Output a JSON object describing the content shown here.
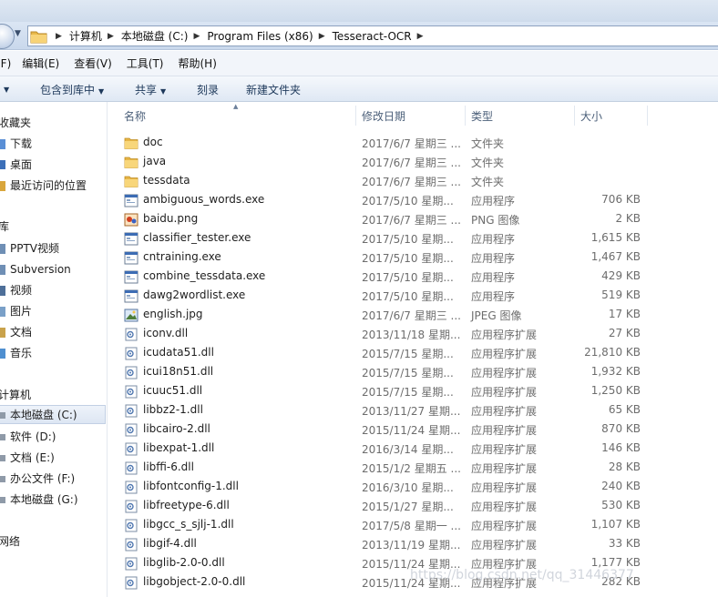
{
  "address": {
    "crumbs": [
      "计算机",
      "本地磁盘 (C:)",
      "Program Files (x86)",
      "Tesseract-OCR"
    ]
  },
  "menu": [
    "(F)",
    "编辑(E)",
    "查看(V)",
    "工具(T)",
    "帮助(H)"
  ],
  "toolbar": {
    "include_label": "包含到库中",
    "share_label": "共享",
    "burn_label": "刻录",
    "new_folder_label": "新建文件夹"
  },
  "nav": {
    "favorites_head": "收藏夹",
    "favorites": [
      "下载",
      "桌面",
      "最近访问的位置"
    ],
    "library_head": "库",
    "libraries": [
      "PPTV视频",
      "Subversion",
      "视频",
      "图片",
      "文档",
      "音乐"
    ],
    "computer_head": "计算机",
    "drives": [
      "本地磁盘 (C:)",
      "软件 (D:)",
      "文档 (E:)",
      "办公文件 (F:)",
      "本地磁盘 (G:)"
    ],
    "network_head": "网络"
  },
  "columns": {
    "name": "名称",
    "date": "修改日期",
    "type": "类型",
    "size": "大小"
  },
  "files": [
    {
      "name": "doc",
      "date": "2017/6/7 星期三 ...",
      "type": "文件夹",
      "size": "",
      "icon": "folder"
    },
    {
      "name": "java",
      "date": "2017/6/7 星期三 ...",
      "type": "文件夹",
      "size": "",
      "icon": "folder"
    },
    {
      "name": "tessdata",
      "date": "2017/6/7 星期三 ...",
      "type": "文件夹",
      "size": "",
      "icon": "folder"
    },
    {
      "name": "ambiguous_words.exe",
      "date": "2017/5/10 星期...",
      "type": "应用程序",
      "size": "706 KB",
      "icon": "exe"
    },
    {
      "name": "baidu.png",
      "date": "2017/6/7 星期三 ...",
      "type": "PNG 图像",
      "size": "2 KB",
      "icon": "png"
    },
    {
      "name": "classifier_tester.exe",
      "date": "2017/5/10 星期...",
      "type": "应用程序",
      "size": "1,615 KB",
      "icon": "exe"
    },
    {
      "name": "cntraining.exe",
      "date": "2017/5/10 星期...",
      "type": "应用程序",
      "size": "1,467 KB",
      "icon": "exe"
    },
    {
      "name": "combine_tessdata.exe",
      "date": "2017/5/10 星期...",
      "type": "应用程序",
      "size": "429 KB",
      "icon": "exe"
    },
    {
      "name": "dawg2wordlist.exe",
      "date": "2017/5/10 星期...",
      "type": "应用程序",
      "size": "519 KB",
      "icon": "exe"
    },
    {
      "name": "english.jpg",
      "date": "2017/6/7 星期三 ...",
      "type": "JPEG 图像",
      "size": "17 KB",
      "icon": "jpg"
    },
    {
      "name": "iconv.dll",
      "date": "2013/11/18 星期...",
      "type": "应用程序扩展",
      "size": "27 KB",
      "icon": "dll"
    },
    {
      "name": "icudata51.dll",
      "date": "2015/7/15 星期...",
      "type": "应用程序扩展",
      "size": "21,810 KB",
      "icon": "dll"
    },
    {
      "name": "icui18n51.dll",
      "date": "2015/7/15 星期...",
      "type": "应用程序扩展",
      "size": "1,932 KB",
      "icon": "dll"
    },
    {
      "name": "icuuc51.dll",
      "date": "2015/7/15 星期...",
      "type": "应用程序扩展",
      "size": "1,250 KB",
      "icon": "dll"
    },
    {
      "name": "libbz2-1.dll",
      "date": "2013/11/27 星期...",
      "type": "应用程序扩展",
      "size": "65 KB",
      "icon": "dll"
    },
    {
      "name": "libcairo-2.dll",
      "date": "2015/11/24 星期...",
      "type": "应用程序扩展",
      "size": "870 KB",
      "icon": "dll"
    },
    {
      "name": "libexpat-1.dll",
      "date": "2016/3/14 星期...",
      "type": "应用程序扩展",
      "size": "146 KB",
      "icon": "dll"
    },
    {
      "name": "libffi-6.dll",
      "date": "2015/1/2 星期五 ...",
      "type": "应用程序扩展",
      "size": "28 KB",
      "icon": "dll"
    },
    {
      "name": "libfontconfig-1.dll",
      "date": "2016/3/10 星期...",
      "type": "应用程序扩展",
      "size": "240 KB",
      "icon": "dll"
    },
    {
      "name": "libfreetype-6.dll",
      "date": "2015/1/27 星期...",
      "type": "应用程序扩展",
      "size": "530 KB",
      "icon": "dll"
    },
    {
      "name": "libgcc_s_sjlj-1.dll",
      "date": "2017/5/8 星期一 ...",
      "type": "应用程序扩展",
      "size": "1,107 KB",
      "icon": "dll"
    },
    {
      "name": "libgif-4.dll",
      "date": "2013/11/19 星期...",
      "type": "应用程序扩展",
      "size": "33 KB",
      "icon": "dll"
    },
    {
      "name": "libglib-2.0-0.dll",
      "date": "2015/11/24 星期...",
      "type": "应用程序扩展",
      "size": "1,177 KB",
      "icon": "dll"
    },
    {
      "name": "libgobject-2.0-0.dll",
      "date": "2015/11/24 星期...",
      "type": "应用程序扩展",
      "size": "282 KB",
      "icon": "dll"
    }
  ],
  "watermark": "https://blog.csdn.net/qq_31446377"
}
